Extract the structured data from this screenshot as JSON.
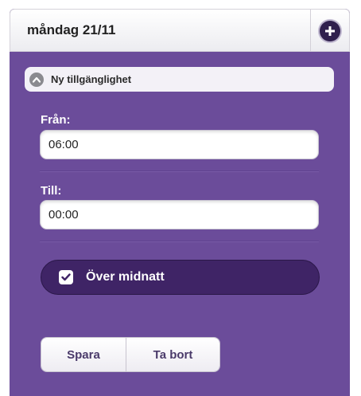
{
  "header": {
    "title": "måndag 21/11",
    "add_icon": "plus-circle-icon"
  },
  "section": {
    "title": "Ny tillgänglighet",
    "collapse_icon": "chevron-up-icon"
  },
  "from_field": {
    "label": "Från:",
    "value": "06:00"
  },
  "to_field": {
    "label": "Till:",
    "value": "00:00"
  },
  "overnight": {
    "label": "Över midnatt",
    "checked": true
  },
  "actions": {
    "save_label": "Spara",
    "delete_label": "Ta bort"
  },
  "colors": {
    "panel": "#6b4c9a",
    "toggle": "#3f2466",
    "header": "#ffffff"
  }
}
